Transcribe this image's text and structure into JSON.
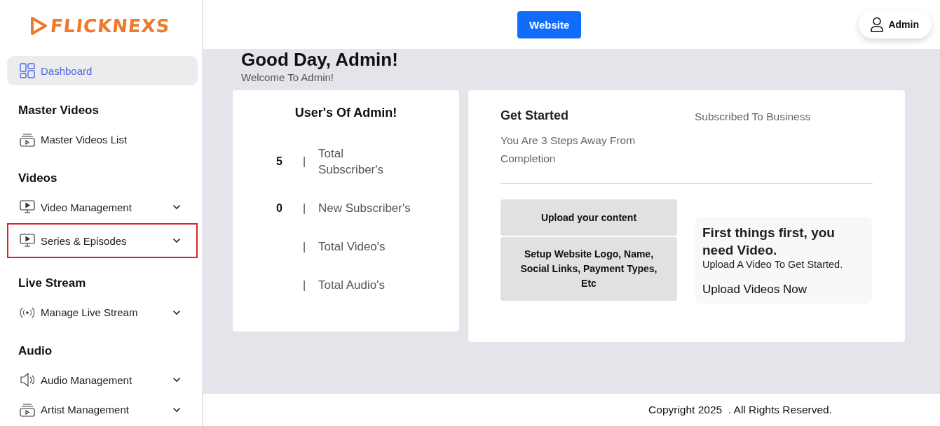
{
  "logo": {
    "text": "FLICKNEXS"
  },
  "sidebar": {
    "sections": [
      {
        "items": [
          {
            "label": "Dashboard",
            "kind": "grid",
            "selected": true,
            "outlined": false,
            "expandable": false
          }
        ]
      },
      {
        "heading": "Master Videos",
        "items": [
          {
            "label": "Master Videos List",
            "kind": "stack",
            "selected": false,
            "outlined": false,
            "expandable": false
          }
        ]
      },
      {
        "heading": "Videos",
        "items": [
          {
            "label": "Video Management",
            "kind": "monitor",
            "selected": false,
            "outlined": false,
            "expandable": true
          },
          {
            "label": "Series & Episodes",
            "kind": "monitor",
            "selected": false,
            "outlined": true,
            "expandable": true
          }
        ]
      },
      {
        "heading": "Live Stream",
        "items": [
          {
            "label": "Manage Live Stream",
            "kind": "broadcast",
            "selected": false,
            "outlined": false,
            "expandable": true
          }
        ]
      },
      {
        "heading": "Audio",
        "items": [
          {
            "label": "Audio Management",
            "kind": "speaker",
            "selected": false,
            "outlined": false,
            "expandable": true
          },
          {
            "label": "Artist Management",
            "kind": "stack",
            "selected": false,
            "outlined": false,
            "expandable": true
          }
        ]
      }
    ]
  },
  "header": {
    "website_button": "Website",
    "user_button": "Admin"
  },
  "greeting": {
    "title": "Good Day, Admin!",
    "subtitle": "Welcome To Admin!"
  },
  "users_card": {
    "title": "User's Of Admin!",
    "stats": [
      {
        "value": "5",
        "separator": "|",
        "label": "Total Subscriber's"
      },
      {
        "value": "0",
        "separator": "|",
        "label": "New Subscriber's"
      },
      {
        "separator": "|",
        "label": "Total Video's"
      },
      {
        "separator": "|",
        "label": "Total Audio's"
      }
    ]
  },
  "get_started": {
    "title": "Get Started",
    "subtitle": "You Are 3 Steps Away From Completion",
    "plan": "Subscribed To Business",
    "steps": [
      "Upload your content",
      "Setup Website Logo, Name, Social Links, Payment Types, Etc"
    ],
    "tip": {
      "title": "First things first, you need Video.",
      "text": "Upload A Video To Get Started.",
      "link": "Upload Videos Now"
    }
  },
  "footer": {
    "copyright": "Copyright 2025  . All Rights Reserved."
  }
}
